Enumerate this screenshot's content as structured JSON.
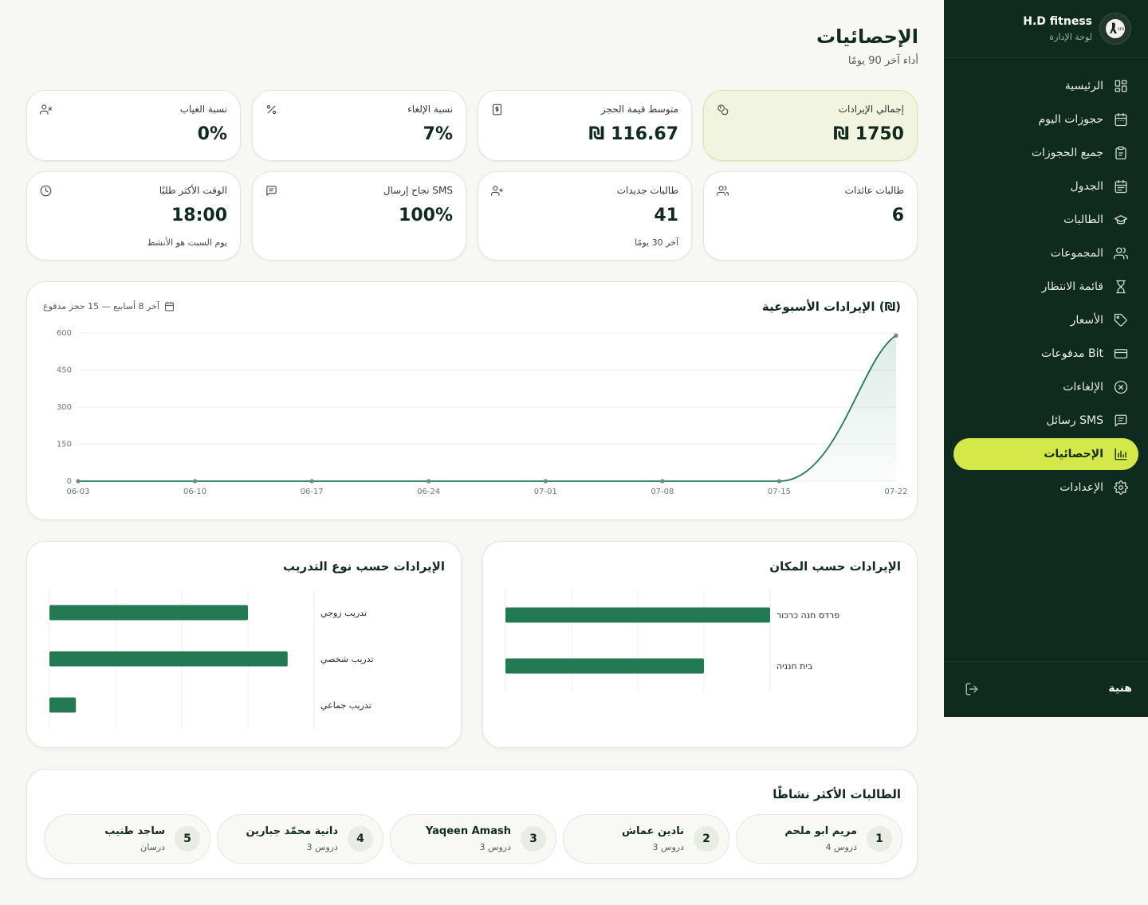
{
  "brand": {
    "name": "H.D fitness",
    "subtitle": "لوحة الإدارة"
  },
  "sidebar": {
    "items": [
      {
        "label": "الرئيسية",
        "icon": "dashboard-grid-icon",
        "active": false
      },
      {
        "label": "حجوزات اليوم",
        "icon": "calendar-icon",
        "active": false
      },
      {
        "label": "جميع الحجوزات",
        "icon": "clipboard-icon",
        "active": false
      },
      {
        "label": "الجدول",
        "icon": "schedule-calendar-icon",
        "active": false
      },
      {
        "label": "الطالبات",
        "icon": "graduation-cap-icon",
        "active": false
      },
      {
        "label": "المجموعات",
        "icon": "users-icon",
        "active": false
      },
      {
        "label": "قائمة الانتظار",
        "icon": "hourglass-icon",
        "active": false
      },
      {
        "label": "الأسعار",
        "icon": "tag-icon",
        "active": false
      },
      {
        "label": "مدفوعات Bit",
        "icon": "credit-card-icon",
        "active": false
      },
      {
        "label": "الإلغاءات",
        "icon": "x-circle-icon",
        "active": false
      },
      {
        "label": "رسائل SMS",
        "icon": "message-icon",
        "active": false
      },
      {
        "label": "الإحصائيات",
        "icon": "bar-chart-icon",
        "active": true
      },
      {
        "label": "الإعدادات",
        "icon": "gear-icon",
        "active": false
      }
    ],
    "user": "هنية"
  },
  "header": {
    "title": "الإحصائيات",
    "subtitle": "أداء آخر 90 يومًا"
  },
  "stats": [
    {
      "label": "إجمالي الإيرادات",
      "value": "₪ 1750",
      "icon": "coins-icon",
      "highlight": true
    },
    {
      "label": "متوسط قيمة الحجز",
      "value": "₪ 116.67",
      "icon": "receipt-icon"
    },
    {
      "label": "نسبة الإلغاء",
      "value": "7%",
      "icon": "percent-icon"
    },
    {
      "label": "نسبة الغياب",
      "value": "0%",
      "icon": "user-x-icon"
    },
    {
      "label": "طالبات عائدات",
      "value": "6",
      "icon": "users-icon"
    },
    {
      "label": "طالبات جديدات",
      "value": "41",
      "note": "آخر 30 يومًا",
      "icon": "user-plus-icon"
    },
    {
      "label": "نجاح إرسال SMS",
      "value": "100%",
      "icon": "message-icon"
    },
    {
      "label": "الوقت الأكثر طلبًا",
      "value": "18:00",
      "note": "يوم السبت هو الأنشط",
      "icon": "clock-icon"
    }
  ],
  "weekly": {
    "title": "الإيرادات الأسبوعية (₪)",
    "meta": "آخر 8 أسابيع — 15 حجز مدفوع"
  },
  "by_location": {
    "title": "الإيرادات حسب المكان"
  },
  "by_type": {
    "title": "الإيرادات حسب نوع التدريب"
  },
  "top_students": {
    "title": "الطالبات الأكثر نشاطًا",
    "items": [
      {
        "rank": "1",
        "name": "مريم ابو ملحم",
        "sub": "4 دروس"
      },
      {
        "rank": "2",
        "name": "نادين عماش",
        "sub": "3 دروس"
      },
      {
        "rank": "3",
        "name": "Yaqeen Amash",
        "sub": "3 دروس"
      },
      {
        "rank": "4",
        "name": "دانية محمّد جبارين",
        "sub": "3 دروس"
      },
      {
        "rank": "5",
        "name": "ساجد طنيب",
        "sub": "درسان"
      }
    ]
  },
  "colors": {
    "sidebar_bg": "#0f2a1e",
    "accent": "#d5e84a",
    "primary": "#217a52"
  },
  "chart_data": [
    {
      "type": "area",
      "title": "الإيرادات الأسبوعية (₪)",
      "x": [
        "06-03",
        "06-10",
        "06-17",
        "06-24",
        "07-01",
        "07-08",
        "07-15",
        "07-22"
      ],
      "values": [
        0,
        0,
        0,
        0,
        0,
        0,
        0,
        590
      ],
      "ylim": [
        0,
        600
      ],
      "yticks": [
        "0",
        "150",
        "300",
        "450",
        "600"
      ],
      "grid": true
    },
    {
      "type": "bar",
      "title": "الإيرادات حسب المكان",
      "categories": [
        "פרדס חנה כרכור",
        "בית חנניה"
      ],
      "values": [
        1000,
        750
      ],
      "xlim": [
        0,
        1000
      ]
    },
    {
      "type": "bar",
      "title": "الإيرادات حسب نوع التدريب",
      "categories": [
        "تدريب زوجي",
        "تدريب شخصي",
        "تدريب جماعي"
      ],
      "values": [
        750,
        900,
        100
      ],
      "xlim": [
        0,
        1000
      ]
    }
  ]
}
